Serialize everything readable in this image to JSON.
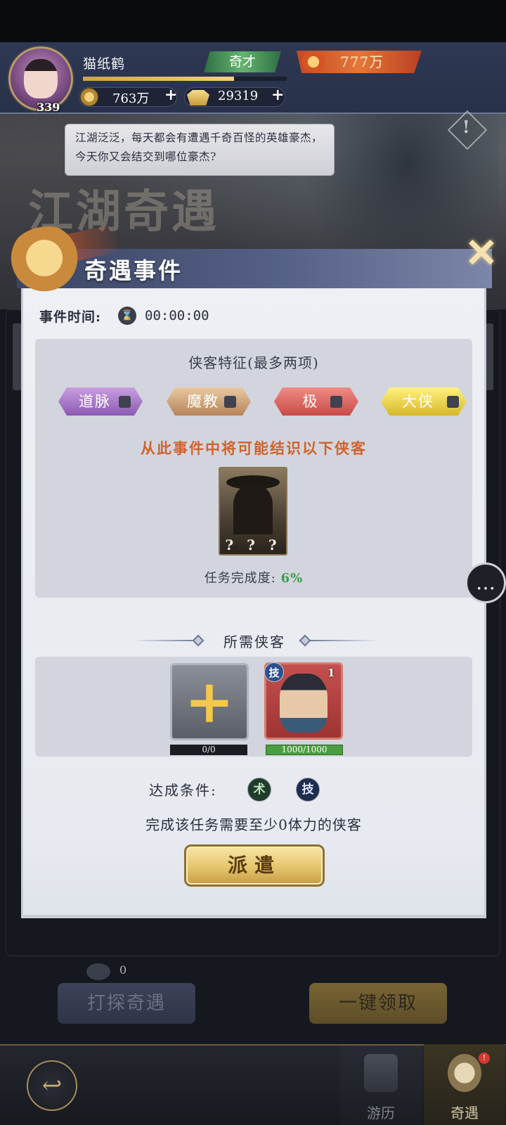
{
  "player": {
    "name": "猫纸鹤",
    "level": "339",
    "rank": "奇才",
    "power": "777万",
    "coins": "763万",
    "ingots": "29319",
    "plus_symbol": "+",
    "exp_fraction": 0.74
  },
  "scene": {
    "speech": "江湖泛泛，每天都会有遭遇千奇百怪的英雄豪杰，今天你又会结交到哪位豪杰?",
    "bg_title": "江湖奇遇",
    "warn_mark": "!"
  },
  "modal": {
    "title": "奇遇事件",
    "close_glyph": "✕",
    "time_label": "事件时间:",
    "hourglass_glyph": "⌛",
    "time_value": "00:00:00",
    "traits_title": "侠客特征(最多两项)",
    "traits": [
      {
        "label": "道脉",
        "color": "#8b5ab4"
      },
      {
        "label": "魔教",
        "color": "#b6845a"
      },
      {
        "label": "极",
        "color": "#c94b47"
      },
      {
        "label": "大侠",
        "color": "#d8b72b"
      }
    ],
    "possible_text": "从此事件中将可能结识以下侠客",
    "mystery_label": "? ? ?",
    "progress_label": "任务完成度:",
    "progress_value": "6%",
    "required_title": "所需侠客",
    "add_slot_glyph": "+",
    "add_slot_count": "0/0",
    "hero": {
      "type_badge": "技",
      "star": "1",
      "hp": "1000/1000",
      "hp_fraction": 1.0
    },
    "condition_label": "达成条件:",
    "conditions": [
      "术",
      "技"
    ],
    "requirement": "完成该任务需要至少0体力的侠客",
    "dispatch_label": "派遣"
  },
  "floating": {
    "chat_glyph": "…"
  },
  "lower": {
    "count": "0",
    "explore_label": "打探奇遇",
    "collect_label": "一键领取"
  },
  "nav": {
    "back_glyph": "↩",
    "tabs": [
      {
        "label": "游历",
        "icon": "scroll-icon"
      },
      {
        "label": "奇遇",
        "icon": "mask-icon"
      }
    ],
    "notif": "!"
  },
  "colors": {
    "accent_gold": "#e5c56c",
    "progress_green": "#3f9a4e",
    "highlight_orange": "#d0622c"
  }
}
